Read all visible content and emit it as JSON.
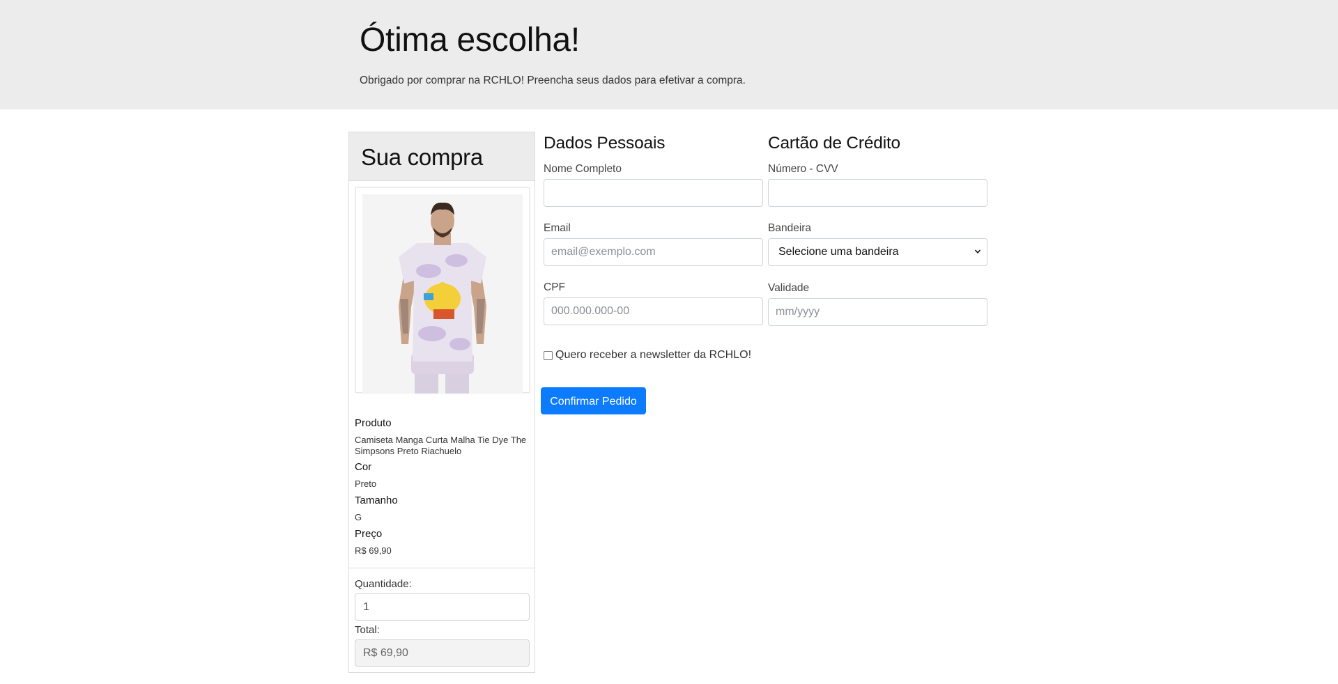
{
  "header": {
    "title": "Ótima escolha!",
    "lead": "Obrigado por comprar na RCHLO! Preencha seus dados para efetivar a compra."
  },
  "order": {
    "title": "Sua compra",
    "product_label": "Produto",
    "product_name": "Camiseta Manga Curta Malha Tie Dye The Simpsons Preto Riachuelo",
    "color_label": "Cor",
    "color_value": "Preto",
    "size_label": "Tamanho",
    "size_value": "G",
    "price_label": "Preço",
    "price_value": "R$ 69,90",
    "quantity_label": "Quantidade:",
    "quantity_value": "1",
    "total_label": "Total:",
    "total_value": "R$ 69,90"
  },
  "personal": {
    "title": "Dados Pessoais",
    "name_label": "Nome Completo",
    "name_value": "",
    "email_label": "Email",
    "email_placeholder": "email@exemplo.com",
    "cpf_label": "CPF",
    "cpf_placeholder": "000.000.000-00"
  },
  "card": {
    "title": "Cartão de Crédito",
    "number_label": "Número - CVV",
    "number_value": "",
    "brand_label": "Bandeira",
    "brand_selected": "Selecione uma bandeira",
    "expiry_label": "Validade",
    "expiry_placeholder": "mm/yyyy"
  },
  "newsletter": {
    "label": "Quero receber a newsletter da RCHLO!",
    "checked": false
  },
  "submit_label": "Confirmar Pedido",
  "colors": {
    "jumbotron_bg": "#edeced",
    "primary": "#0d7bfe",
    "border": "#ced4da"
  }
}
